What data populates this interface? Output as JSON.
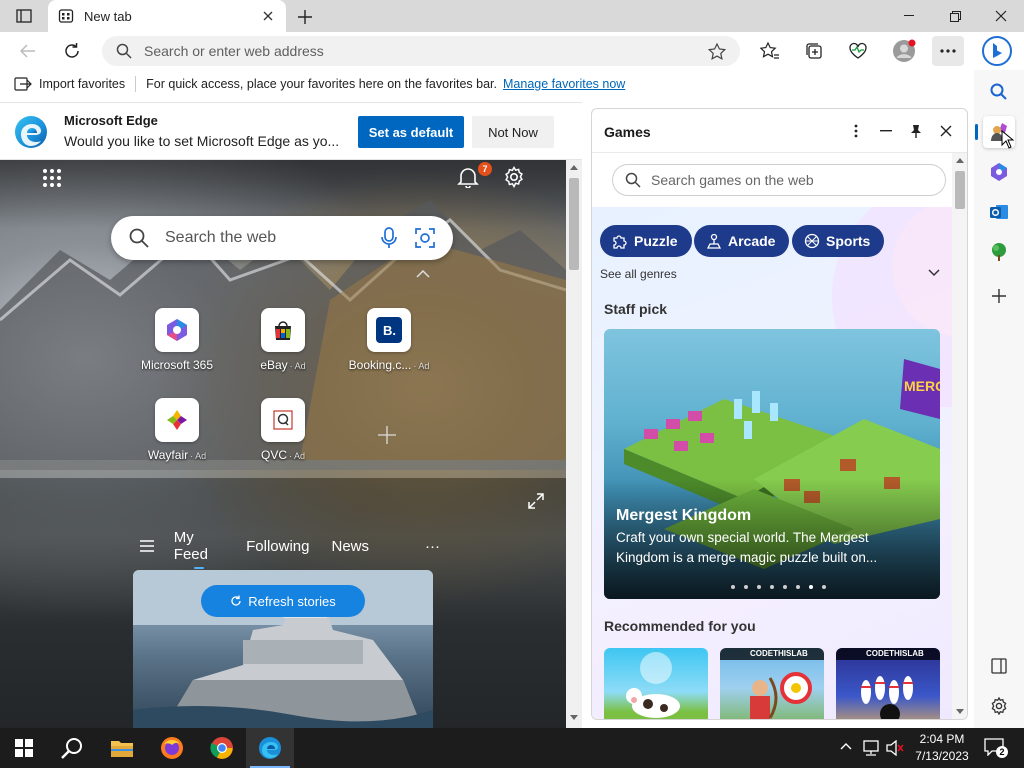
{
  "browser": {
    "tab_title": "New tab",
    "address_placeholder": "Search or enter web address"
  },
  "favorites_bar": {
    "import_label": "Import favorites",
    "message": "For quick access, place your favorites here on the favorites bar.",
    "link": "Manage favorites now"
  },
  "default_bar": {
    "title": "Microsoft Edge",
    "message": "Would you like to set Microsoft Edge as yo...",
    "primary_button": "Set as default",
    "secondary_button": "Not Now"
  },
  "ntp": {
    "notification_count": "7",
    "search_placeholder": "Search the web",
    "tiles": [
      {
        "label": "Microsoft 365",
        "ad": ""
      },
      {
        "label": "eBay",
        "ad": "· Ad"
      },
      {
        "label": "Booking.c...",
        "ad": "· Ad"
      },
      {
        "label": "Wayfair",
        "ad": "· Ad"
      },
      {
        "label": "QVC",
        "ad": "· Ad"
      }
    ],
    "feed_tabs": [
      "My Feed",
      "Following",
      "News"
    ],
    "feed_more": "···",
    "refresh_label": "Refresh stories"
  },
  "games": {
    "title": "Games",
    "search_placeholder": "Search games on the web",
    "genres": [
      "Puzzle",
      "Arcade",
      "Sports"
    ],
    "see_all": "See all genres",
    "staff_pick_heading": "Staff pick",
    "staff_pick": {
      "title": "Mergest Kingdom",
      "description": "Craft your own special world. The Mergest Kingdom is a merge magic puzzle built on...",
      "logo_text": "MERGEST KING",
      "slides": 8,
      "active_slide": 7
    },
    "recommended_heading": "Recommended for you",
    "recommended_caption": "CODETHISLAB"
  },
  "taskbar": {
    "time": "2:04 PM",
    "date": "7/13/2023",
    "notifications": "2"
  },
  "colors": {
    "accent": "#0067c0",
    "chip_bg": "#1e3a8a",
    "badge": "#e3501c",
    "refresh": "#1683e0"
  }
}
